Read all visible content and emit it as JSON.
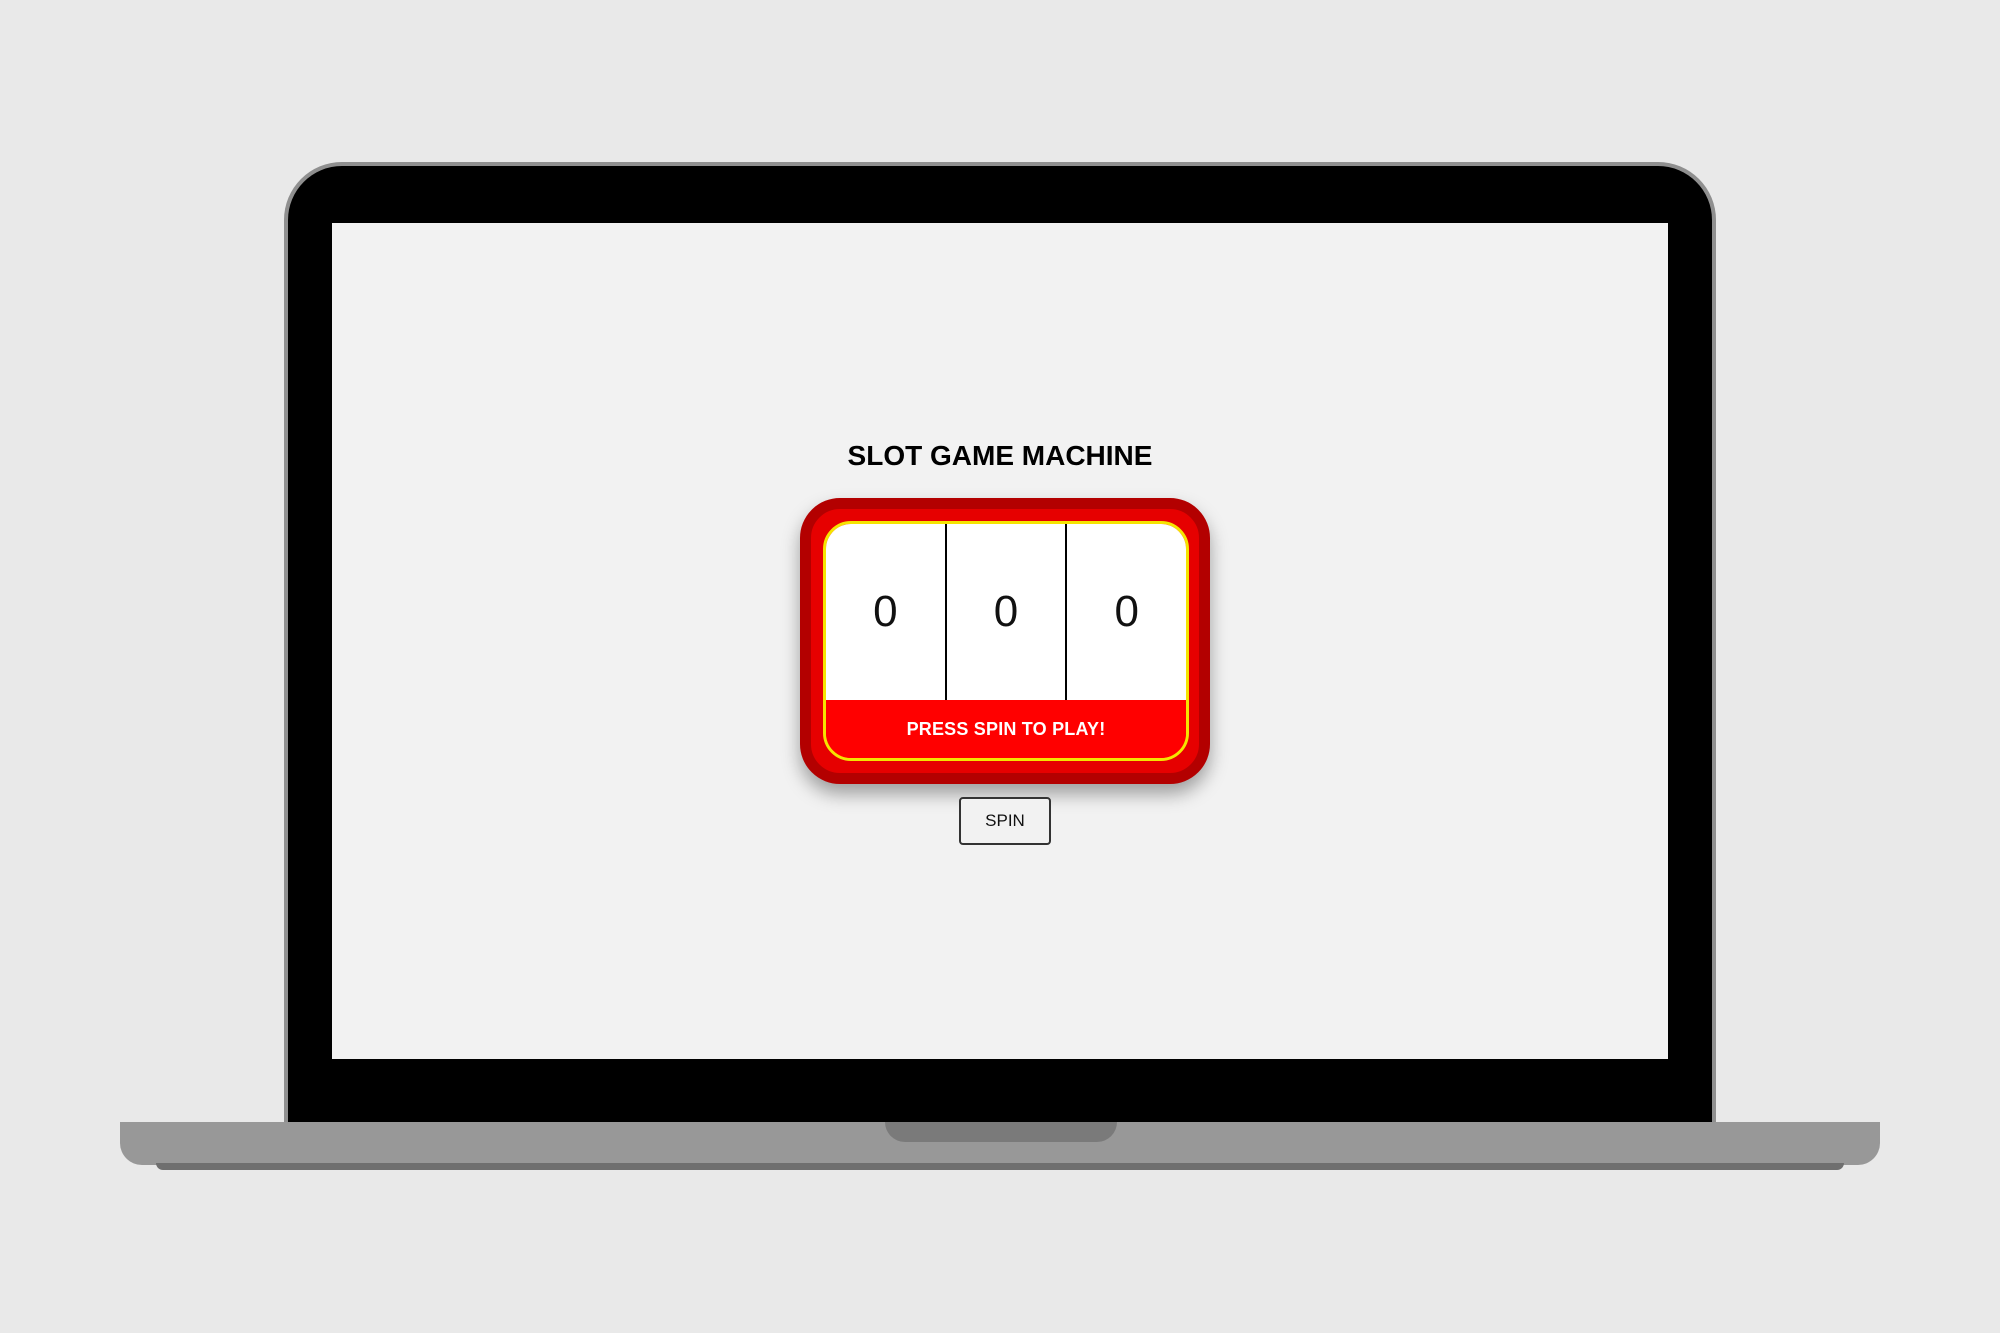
{
  "game": {
    "title": "SLOT GAME MACHINE",
    "reels": [
      "0",
      "0",
      "0"
    ],
    "status": "PRESS SPIN TO PLAY!",
    "spin_label": "SPIN"
  },
  "colors": {
    "machine_outer": "#b30000",
    "machine_body": "#ff0000",
    "machine_trim": "#f5e400",
    "screen_bg": "#f2f2f2",
    "page_bg": "#e9e9e9"
  }
}
